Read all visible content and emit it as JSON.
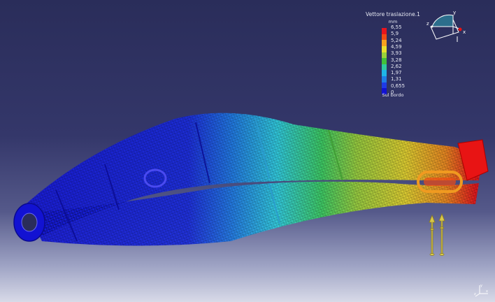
{
  "legend": {
    "title": "Vettore traslazione.1",
    "unit": "mm",
    "values": [
      "6,55",
      "5,9",
      "5,24",
      "4,59",
      "3,93",
      "3,28",
      "2,62",
      "1,97",
      "1,31",
      "0,655",
      "0"
    ],
    "colors": [
      "#e8141e",
      "#f04a14",
      "#f7a21e",
      "#e8e12d",
      "#9ad23a",
      "#42c03a",
      "#2fc9a0",
      "#1fb5e6",
      "#1f7de6",
      "#1f3be6",
      "#1212d2"
    ],
    "footer": "Sul bordo"
  },
  "compass": {
    "label_y": "y",
    "label_z": "z",
    "label_x": "x"
  },
  "triad": {
    "label_y": "y",
    "label_x": "x",
    "label_z": "z"
  },
  "model": {
    "gradient_colors": [
      "#1414d8",
      "#1a2ce0",
      "#1f7de6",
      "#2fd0e0",
      "#3cd060",
      "#9ad23a",
      "#e6d42a",
      "#f08a1a",
      "#e81414"
    ]
  }
}
